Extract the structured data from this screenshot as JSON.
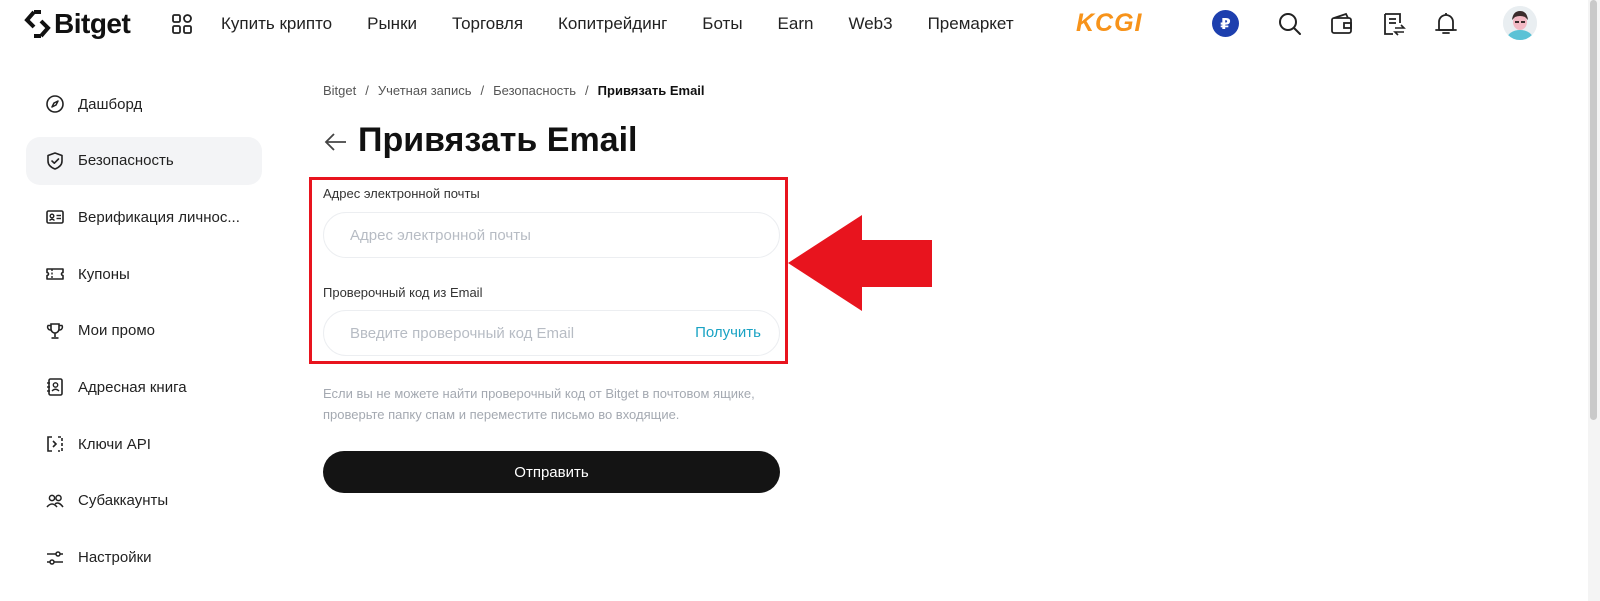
{
  "brand": {
    "logo_text": "Bitget"
  },
  "nav": {
    "links": [
      "Купить крипто",
      "Рынки",
      "Торговля",
      "Копитрейдинг",
      "Боты",
      "Earn",
      "Web3",
      "Премаркет"
    ],
    "promo_logo": "KCGI",
    "currency_symbol": "₽",
    "icons": [
      "apps-grid-icon",
      "search-icon",
      "wallet-icon",
      "orders-icon",
      "bell-icon",
      "user-avatar"
    ]
  },
  "sidebar": {
    "items": [
      {
        "label": "Дашборд",
        "icon": "compass-icon",
        "active": false
      },
      {
        "label": "Безопасность",
        "icon": "shield-icon",
        "active": true
      },
      {
        "label": "Верификация личнос...",
        "icon": "id-card-icon",
        "active": false
      },
      {
        "label": "Купоны",
        "icon": "ticket-icon",
        "active": false
      },
      {
        "label": "Мои промо",
        "icon": "trophy-icon",
        "active": false
      },
      {
        "label": "Адресная книга",
        "icon": "address-book-icon",
        "active": false
      },
      {
        "label": "Ключи API",
        "icon": "api-key-icon",
        "active": false
      },
      {
        "label": "Субаккаунты",
        "icon": "users-icon",
        "active": false
      },
      {
        "label": "Настройки",
        "icon": "sliders-icon",
        "active": false
      }
    ]
  },
  "breadcrumb": [
    "Bitget",
    "Учетная запись",
    "Безопасность",
    "Привязать Email"
  ],
  "page": {
    "title": "Привязать Email",
    "email_label": "Адрес электронной почты",
    "email_placeholder": "Адрес электронной почты",
    "email_value": "",
    "code_label": "Проверочный код из Email",
    "code_placeholder": "Введите проверочный код Email",
    "code_value": "",
    "get_code_label": "Получить",
    "hint": "Если вы не можете найти проверочный код от Bitget в почтовом ящике, проверьте папку спам и переместите письмо во входящие.",
    "submit_label": "Отправить"
  },
  "annotation": {
    "highlight_color": "#e8141e",
    "arrow_color": "#e8141e"
  },
  "colors": {
    "accent_link": "#1aa3c4",
    "button_bg": "#141414",
    "active_item_bg": "#f3f4f6",
    "promo": "#f7931a",
    "currency_badge": "#1d3fae"
  }
}
